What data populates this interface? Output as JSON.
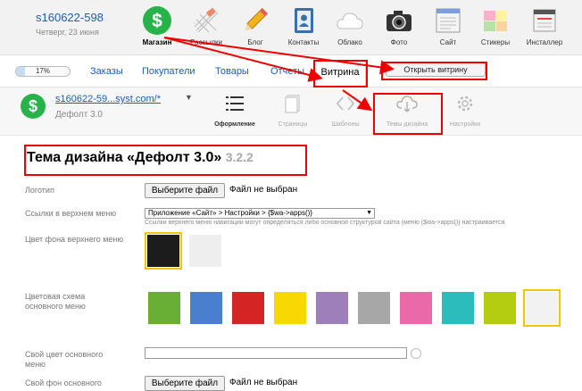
{
  "account": {
    "name": "s160622-598",
    "date": "Четверг, 23 июня"
  },
  "apps": [
    {
      "label": "Магазин",
      "icon": "shop-dollar-icon"
    },
    {
      "label": "Рассылки",
      "icon": "mailer-icon"
    },
    {
      "label": "Блог",
      "icon": "pencil-icon"
    },
    {
      "label": "Контакты",
      "icon": "contacts-book-icon"
    },
    {
      "label": "Облако",
      "icon": "cloud-icon"
    },
    {
      "label": "Фото",
      "icon": "camera-icon"
    },
    {
      "label": "Сайт",
      "icon": "site-window-icon"
    },
    {
      "label": "Стикеры",
      "icon": "stickers-icon"
    },
    {
      "label": "Инсталлер",
      "icon": "installer-icon"
    }
  ],
  "progress": {
    "text": "17%",
    "value": 0.17
  },
  "nav": {
    "orders": "Заказы",
    "customers": "Покупатели",
    "products": "Товары",
    "reports": "Отчеты",
    "showcase": "Витрина",
    "open_showcase": "Открыть витрину"
  },
  "site": {
    "url": "s160622-59...syst.com/*",
    "arrow": "▼",
    "theme": "Дефолт 3.0"
  },
  "tools": [
    {
      "label": "Оформление",
      "icon": "list-icon"
    },
    {
      "label": "Страницы",
      "icon": "pages-icon"
    },
    {
      "label": "Шаблоны",
      "icon": "code-brackets-icon"
    },
    {
      "label": "Темы дизайна",
      "icon": "cloud-download-icon"
    },
    {
      "label": "Настройки",
      "icon": "gear-icon"
    }
  ],
  "content": {
    "title": "Тема дизайна «Дефолт 3.0»",
    "version": "3.2.2",
    "logo_label": "Логотип",
    "choose_file": "Выберите файл",
    "no_file": "Файл не выбран",
    "top_menu_label": "Ссылки в верхнем меню",
    "top_menu_value": "Приложение «Сайт» > Настройки > {$wa->apps()}",
    "top_menu_hint": "Ссылки верхнего меню навигации могут определяться либо основной структурой сайта (меню {$wa->apps()} настраивается",
    "top_bg_label": "Цвет фона верхнего меню",
    "scheme_label": "Цветовая схема основного меню",
    "own_color_label": "Свой цвет основного меню",
    "own_bg_label": "Свой фон основного меню"
  },
  "top_bg_colors": [
    "#1c1c1c",
    "#eeeeee"
  ],
  "scheme_colors": [
    "#6aaf35",
    "#4a7fd0",
    "#d42424",
    "#f7d800",
    "#9e7fb9",
    "#a7a7a7",
    "#ea6aa9",
    "#2cbcbc",
    "#b5cd10",
    "#f2f2f2"
  ],
  "accent": "#e00000"
}
